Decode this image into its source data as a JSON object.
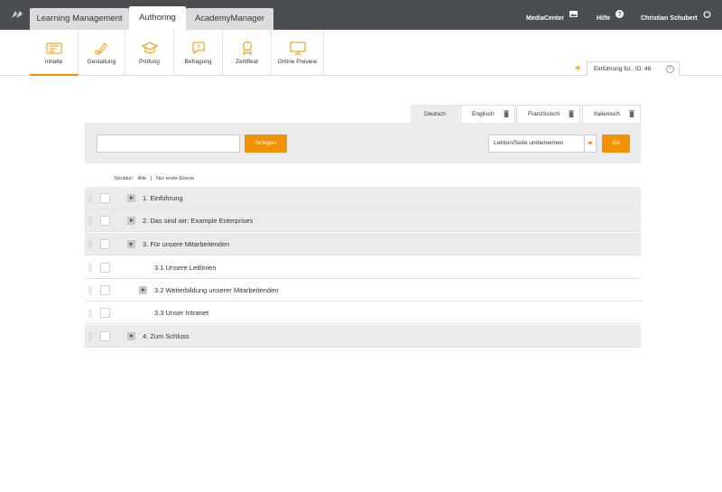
{
  "app_tabs": [
    {
      "label": "Learning Management"
    },
    {
      "label": "Authoring"
    },
    {
      "label": "AcademyManager"
    }
  ],
  "header": {
    "media_center": "MediaCenter",
    "help": "Hilfe",
    "user": "Christian Schubert"
  },
  "toolbar": {
    "items": [
      {
        "label": "Inhalte",
        "icon": "content-icon"
      },
      {
        "label": "Gestaltung",
        "icon": "design-icon"
      },
      {
        "label": "Prüfung",
        "icon": "exam-icon"
      },
      {
        "label": "Befragung",
        "icon": "survey-icon"
      },
      {
        "label": "Zertifikat",
        "icon": "certificate-icon"
      },
      {
        "label": "Online Preview",
        "icon": "preview-icon"
      }
    ]
  },
  "doc_tab": {
    "label": "Einführung für.. ID: 48",
    "add": "+"
  },
  "languages": [
    {
      "label": "Deutsch"
    },
    {
      "label": "Englisch"
    },
    {
      "label": "Französisch"
    },
    {
      "label": "Italienisch"
    }
  ],
  "create": {
    "input_value": "",
    "button": "Anlegen"
  },
  "action": {
    "selected": "Lektion/Seite umbenennen",
    "go": "Go"
  },
  "structure": {
    "label": "Struktur:",
    "all": "Alle",
    "separator": "|",
    "first_level": "Nur erste Ebene"
  },
  "tree": [
    {
      "label": "1. Einführung"
    },
    {
      "label": "2. Das sind wir: Example Enterprises"
    },
    {
      "label": "3. Für unsere Mitarbeitenden"
    },
    {
      "label": "3.1 Unsere Leitlinien"
    },
    {
      "label": "3.2 Weiterbildung unserer Mitarbeitenden"
    },
    {
      "label": "3.3 Unser Intranet"
    },
    {
      "label": "4. Zum Schluss"
    }
  ],
  "colors": {
    "accent": "#f39200",
    "topbar": "#4a4d52",
    "panel": "#ebebeb"
  }
}
